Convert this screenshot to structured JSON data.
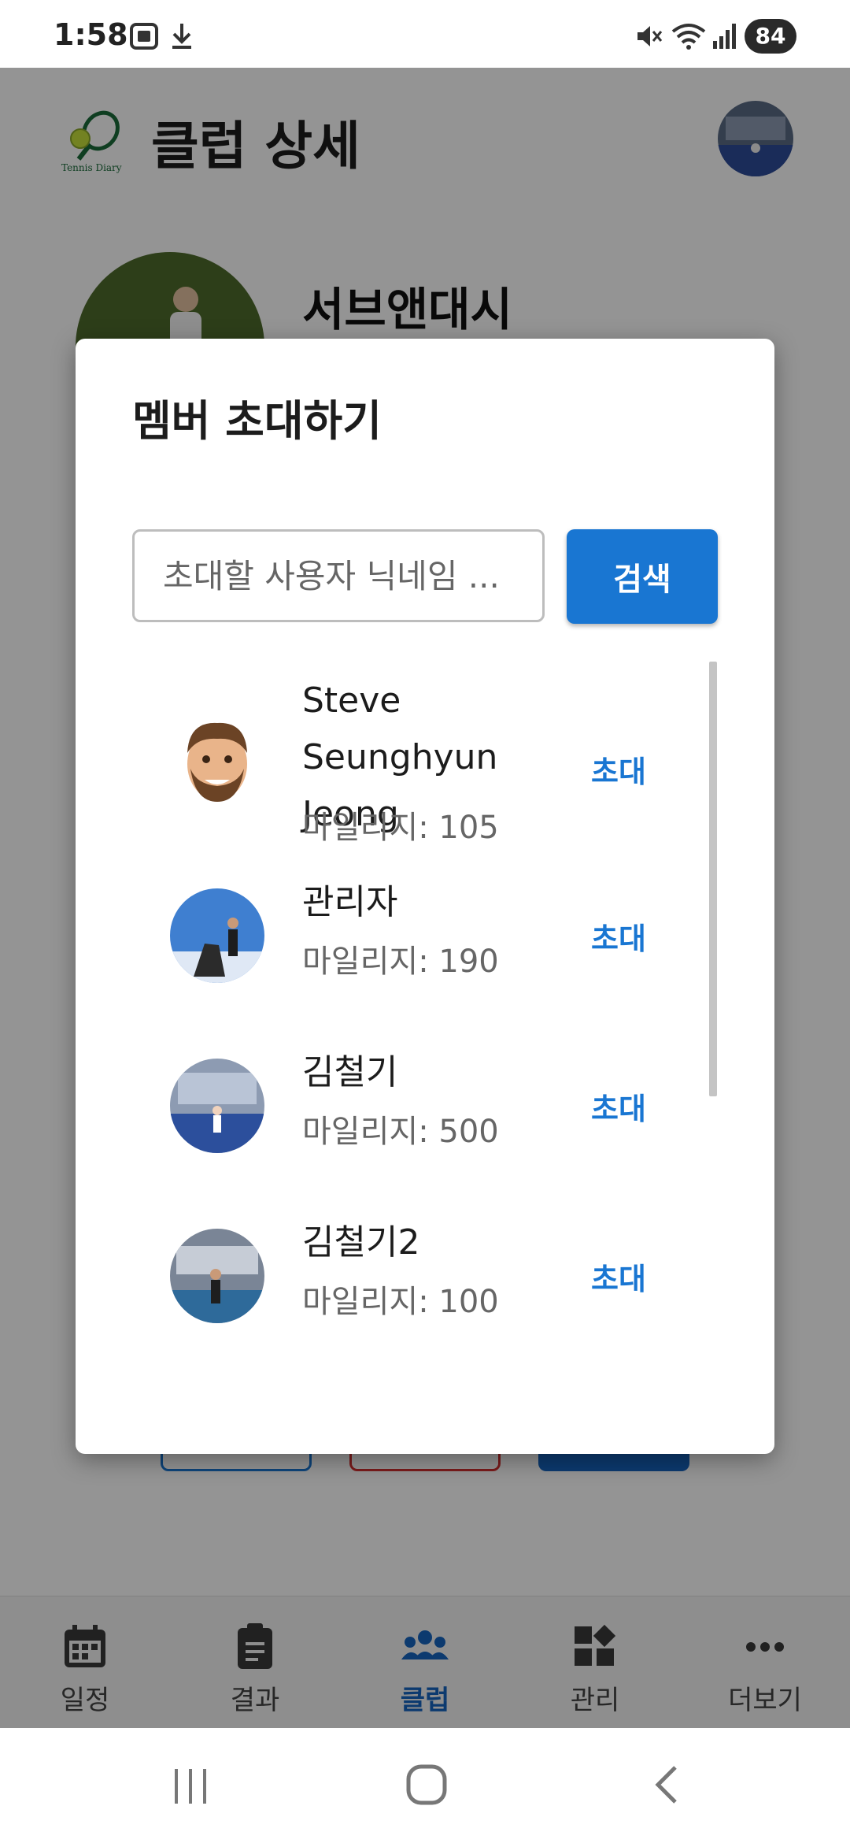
{
  "status_bar": {
    "time": "1:58",
    "battery": "84"
  },
  "header": {
    "logo_text": "Tennis Diary",
    "title": "클럽 상세"
  },
  "club": {
    "name": "서브앤대시"
  },
  "dialog": {
    "title": "멤버 초대하기",
    "search": {
      "placeholder": "초대할 사용자 닉네임 ...",
      "value": ""
    },
    "search_button": "검색",
    "results": [
      {
        "name": "Steve Seunghyun Jeong",
        "mileage": "마일리지: 105",
        "invite": "초대",
        "avatar": "memoji-avatar"
      },
      {
        "name": "관리자",
        "mileage": "마일리지: 190",
        "invite": "초대",
        "avatar": "photo-avatar"
      },
      {
        "name": "김철기",
        "mileage": "마일리지: 500",
        "invite": "초대",
        "avatar": "photo-avatar"
      },
      {
        "name": "김철기2",
        "mileage": "마일리지: 100",
        "invite": "초대",
        "avatar": "photo-avatar"
      }
    ]
  },
  "bottom_nav": [
    {
      "label": "일정",
      "icon": "calendar-icon"
    },
    {
      "label": "결과",
      "icon": "clipboard-icon"
    },
    {
      "label": "클럽",
      "icon": "group-icon",
      "active": true
    },
    {
      "label": "관리",
      "icon": "dashboard-icon"
    },
    {
      "label": "더보기",
      "icon": "more-icon"
    }
  ],
  "colors": {
    "primary": "#1976d2",
    "nav_active": "#1565c0",
    "scrim": "rgba(0,0,0,0.42)"
  }
}
